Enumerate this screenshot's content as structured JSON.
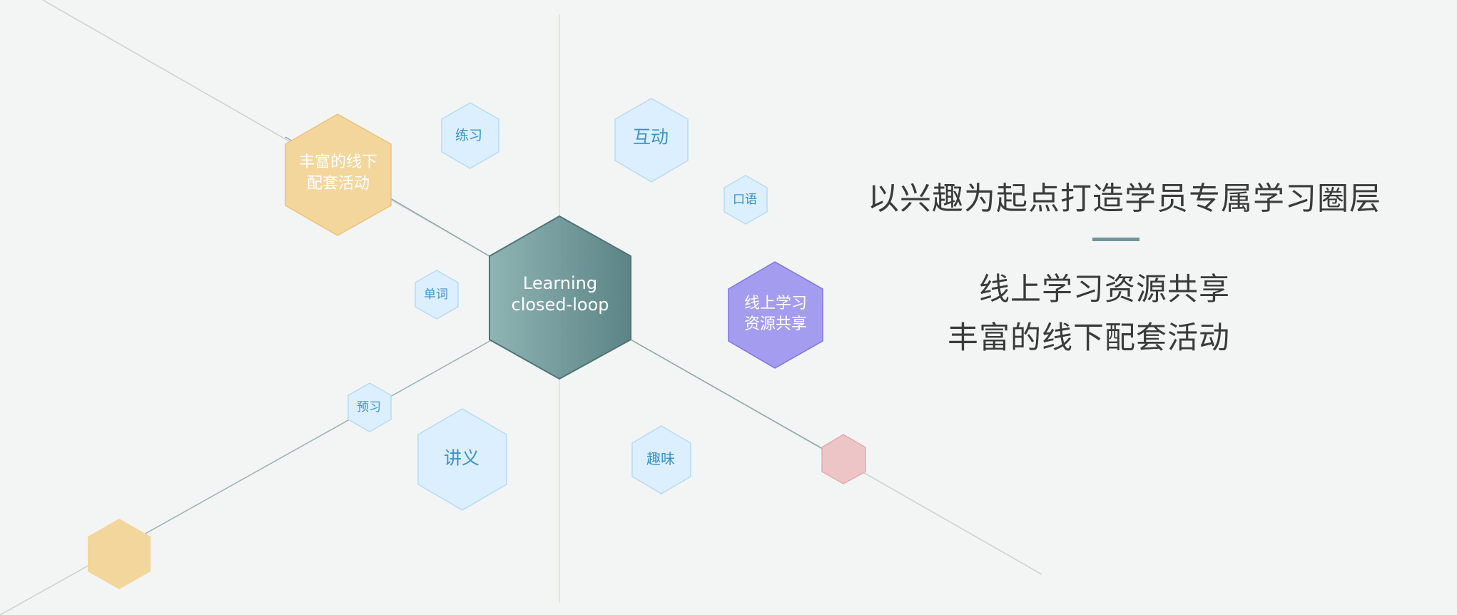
{
  "center": {
    "line1": "Learning",
    "line2": "closed-loop"
  },
  "nodes": {
    "offline_activities": {
      "line1": "丰富的线下",
      "line2": "配套活动"
    },
    "online_resources": {
      "line1": "线上学习",
      "line2": "资源共享"
    },
    "practice": "练习",
    "interaction": "互动",
    "speaking": "口语",
    "vocabulary": "单词",
    "preview": "预习",
    "handout": "讲义",
    "interest": "趣味"
  },
  "text_panel": {
    "headline": "以兴趣为起点打造学员专属学习圈层",
    "line1": "线上学习资源共享",
    "line2": "丰富的线下配套活动"
  },
  "colors": {
    "center_dark": "#5f8789",
    "center_light": "#8fb3b3",
    "offline_fill": "#f3d69c",
    "online_fill": "#a49cef",
    "small_fill": "#dcefff",
    "small_text": "#3b93c9",
    "pink_fill": "#eec5c7",
    "accent": "#6e969a"
  }
}
